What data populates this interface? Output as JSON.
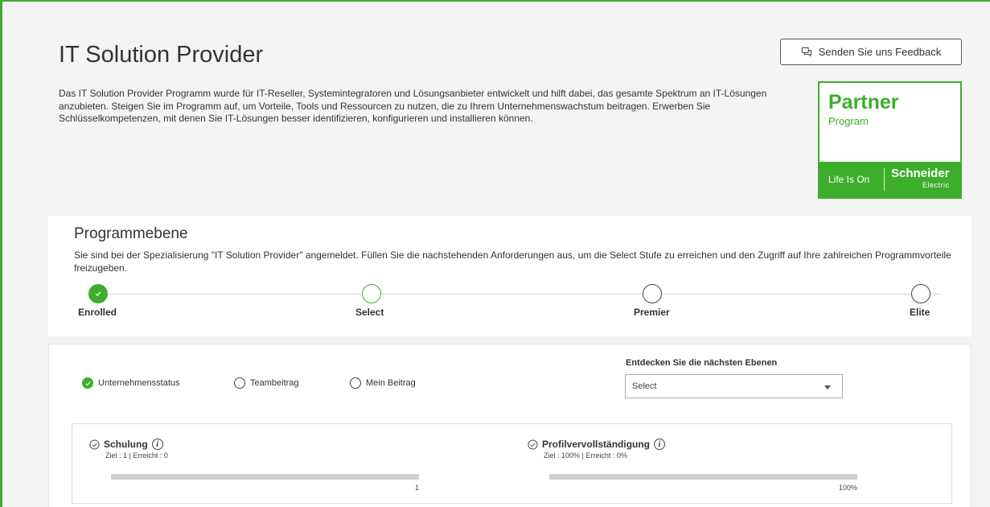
{
  "header": {
    "title": "IT Solution Provider",
    "feedback_label": "Senden Sie uns Feedback",
    "intro": "Das IT Solution Provider Programm wurde für IT-Reseller, Systemintegratoren und Lösungsanbieter entwickelt und hilft dabei, das gesamte Spektrum an IT-Lösungen anzubieten. Steigen Sie im Programm auf, um Vorteile, Tools und Ressourcen zu nutzen, die zu Ihrem Unternehmenswachstum beitragen. Erwerben Sie Schlüsselkompetenzen, mit denen Sie IT-Lösungen besser identifizieren, konfigurieren und installieren können."
  },
  "logo": {
    "title": "Partner",
    "subtitle": "Program",
    "tagline": "Life Is On",
    "brand": "Schneider",
    "brand_sub": "Electric",
    "color": "#3dae2b"
  },
  "program_level": {
    "title": "Programmebene",
    "description": "Sie sind bei der Spezialisierung \"IT Solution Provider\" angemeldet. Füllen Sie die nachstehenden Anforderungen aus, um die Select Stufe zu erreichen und den Zugriff auf Ihre zahlreichen Programmvorteile freizugeben.",
    "steps": [
      {
        "label": "Enrolled",
        "state": "done"
      },
      {
        "label": "Select",
        "state": "current"
      },
      {
        "label": "Premier",
        "state": "todo"
      },
      {
        "label": "Elite",
        "state": "todo"
      }
    ]
  },
  "filters": {
    "options": [
      {
        "label": "Unternehmensstatus",
        "checked": true
      },
      {
        "label": "Teambeitrag",
        "checked": false
      },
      {
        "label": "Mein Beitrag",
        "checked": false
      }
    ],
    "discover_label": "Entdecken Sie die nächsten Ebenen",
    "select_value": "Select"
  },
  "requirements": [
    {
      "title": "Schulung",
      "meta": "Ziel : 1  |  Erreicht : 0",
      "progress": 0,
      "bar_label": "1"
    },
    {
      "title": "Profilvervollständigung",
      "meta": "Ziel : 100%  |  Erreicht : 0%",
      "progress": 0,
      "bar_label": "100%"
    }
  ]
}
